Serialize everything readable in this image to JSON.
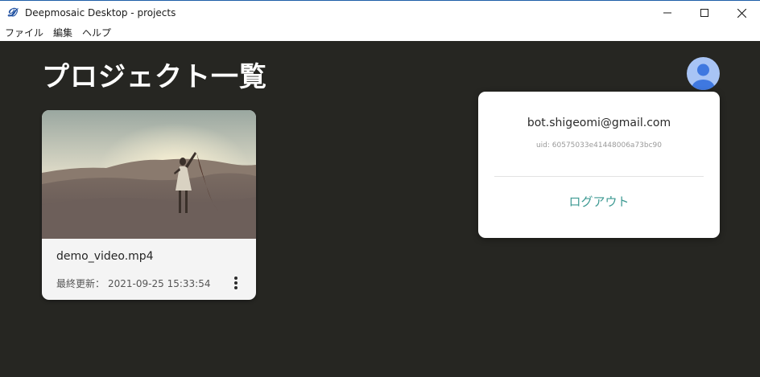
{
  "window": {
    "title": "Deepmosaic Desktop - projects",
    "app_icon": "𝓓"
  },
  "menu": {
    "items": [
      "ファイル",
      "編集",
      "ヘルプ"
    ]
  },
  "page": {
    "title": "プロジェクト一覧"
  },
  "projects": [
    {
      "name": "demo_video.mp4",
      "updated_label": "最終更新：",
      "updated_value": "2021-09-25 15:33:54",
      "thumbnail": "desert-dancer-image"
    }
  ],
  "account": {
    "avatar_icon": "user-avatar-icon",
    "email": "bot.shigeomi@gmail.com",
    "uid": "uid: 60575033e41448006a73bc90",
    "logout_label": "ログアウト"
  },
  "colors": {
    "background": "#262622",
    "accent": "#3e9a93",
    "avatar": "#a8c4f5"
  }
}
